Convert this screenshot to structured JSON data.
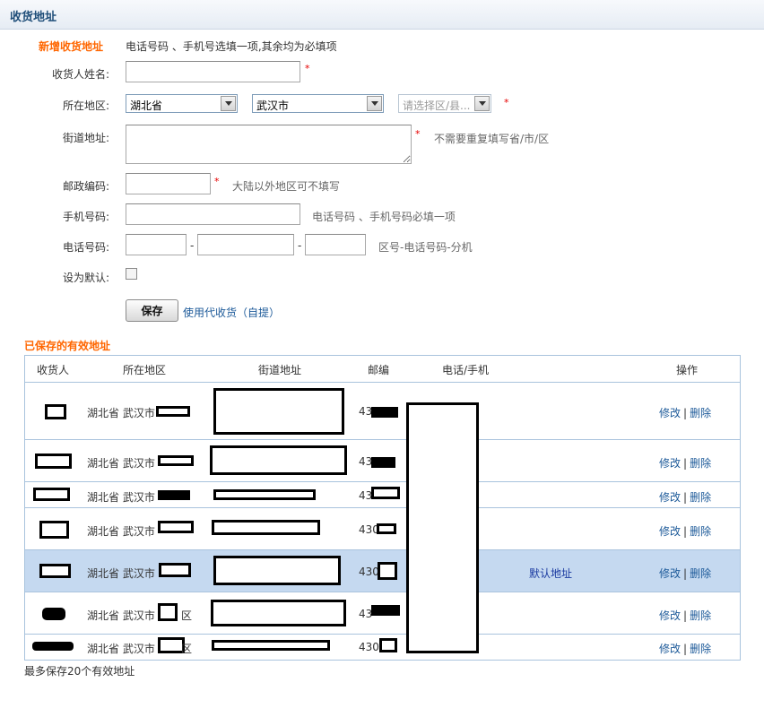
{
  "header": {
    "title": "收货地址"
  },
  "form": {
    "section_title": "新增收货地址",
    "hint": "电话号码 、手机号选填一项,其余均为必填项",
    "required_mark": "*",
    "name_label": "收货人姓名:",
    "region_label": "所在地区:",
    "province_value": "湖北省",
    "city_value": "武汉市",
    "district_value": "请选择区/县...",
    "street_label": "街道地址:",
    "street_hint": "不需要重复填写省/市/区",
    "zip_label": "邮政编码:",
    "zip_hint": "大陆以外地区可不填写",
    "mobile_label": "手机号码:",
    "mobile_hint": "电话号码 、手机号码必填一项",
    "phone_label": "电话号码:",
    "phone_dash": "-",
    "phone_hint": "区号-电话号码-分机",
    "default_label": "设为默认:",
    "save_label": "保存",
    "use_pickup_link": "使用代收货（自提）"
  },
  "saved": {
    "title": "已保存的有效地址",
    "columns": [
      "收货人",
      "所在地区",
      "街道地址",
      "邮编",
      "电话/手机",
      "操作"
    ],
    "rows": [
      {
        "region": "湖北省 武汉市",
        "zip": "43",
        "default_label": "",
        "edit": "修改",
        "delete": "删除"
      },
      {
        "region": "湖北省 武汉市",
        "zip": "43",
        "default_label": "",
        "edit": "修改",
        "delete": "删除"
      },
      {
        "region": "湖北省 武汉市",
        "zip": "43",
        "default_label": "",
        "edit": "修改",
        "delete": "删除"
      },
      {
        "region": "湖北省 武汉市",
        "zip": "430",
        "default_label": "",
        "edit": "修改",
        "delete": "删除"
      },
      {
        "region": "湖北省 武汉市",
        "zip": "430",
        "default_label": "默认地址",
        "edit": "修改",
        "delete": "删除"
      },
      {
        "region": "湖北省 武汉市",
        "zip": "43",
        "district_suffix": "区",
        "default_label": "",
        "edit": "修改",
        "delete": "删除"
      },
      {
        "region": "湖北省 武汉市",
        "zip": "430",
        "district_suffix": "区",
        "default_label": "",
        "edit": "修改",
        "delete": "删除"
      }
    ],
    "link_separator": "|",
    "footer_note": "最多保存20个有效地址"
  }
}
